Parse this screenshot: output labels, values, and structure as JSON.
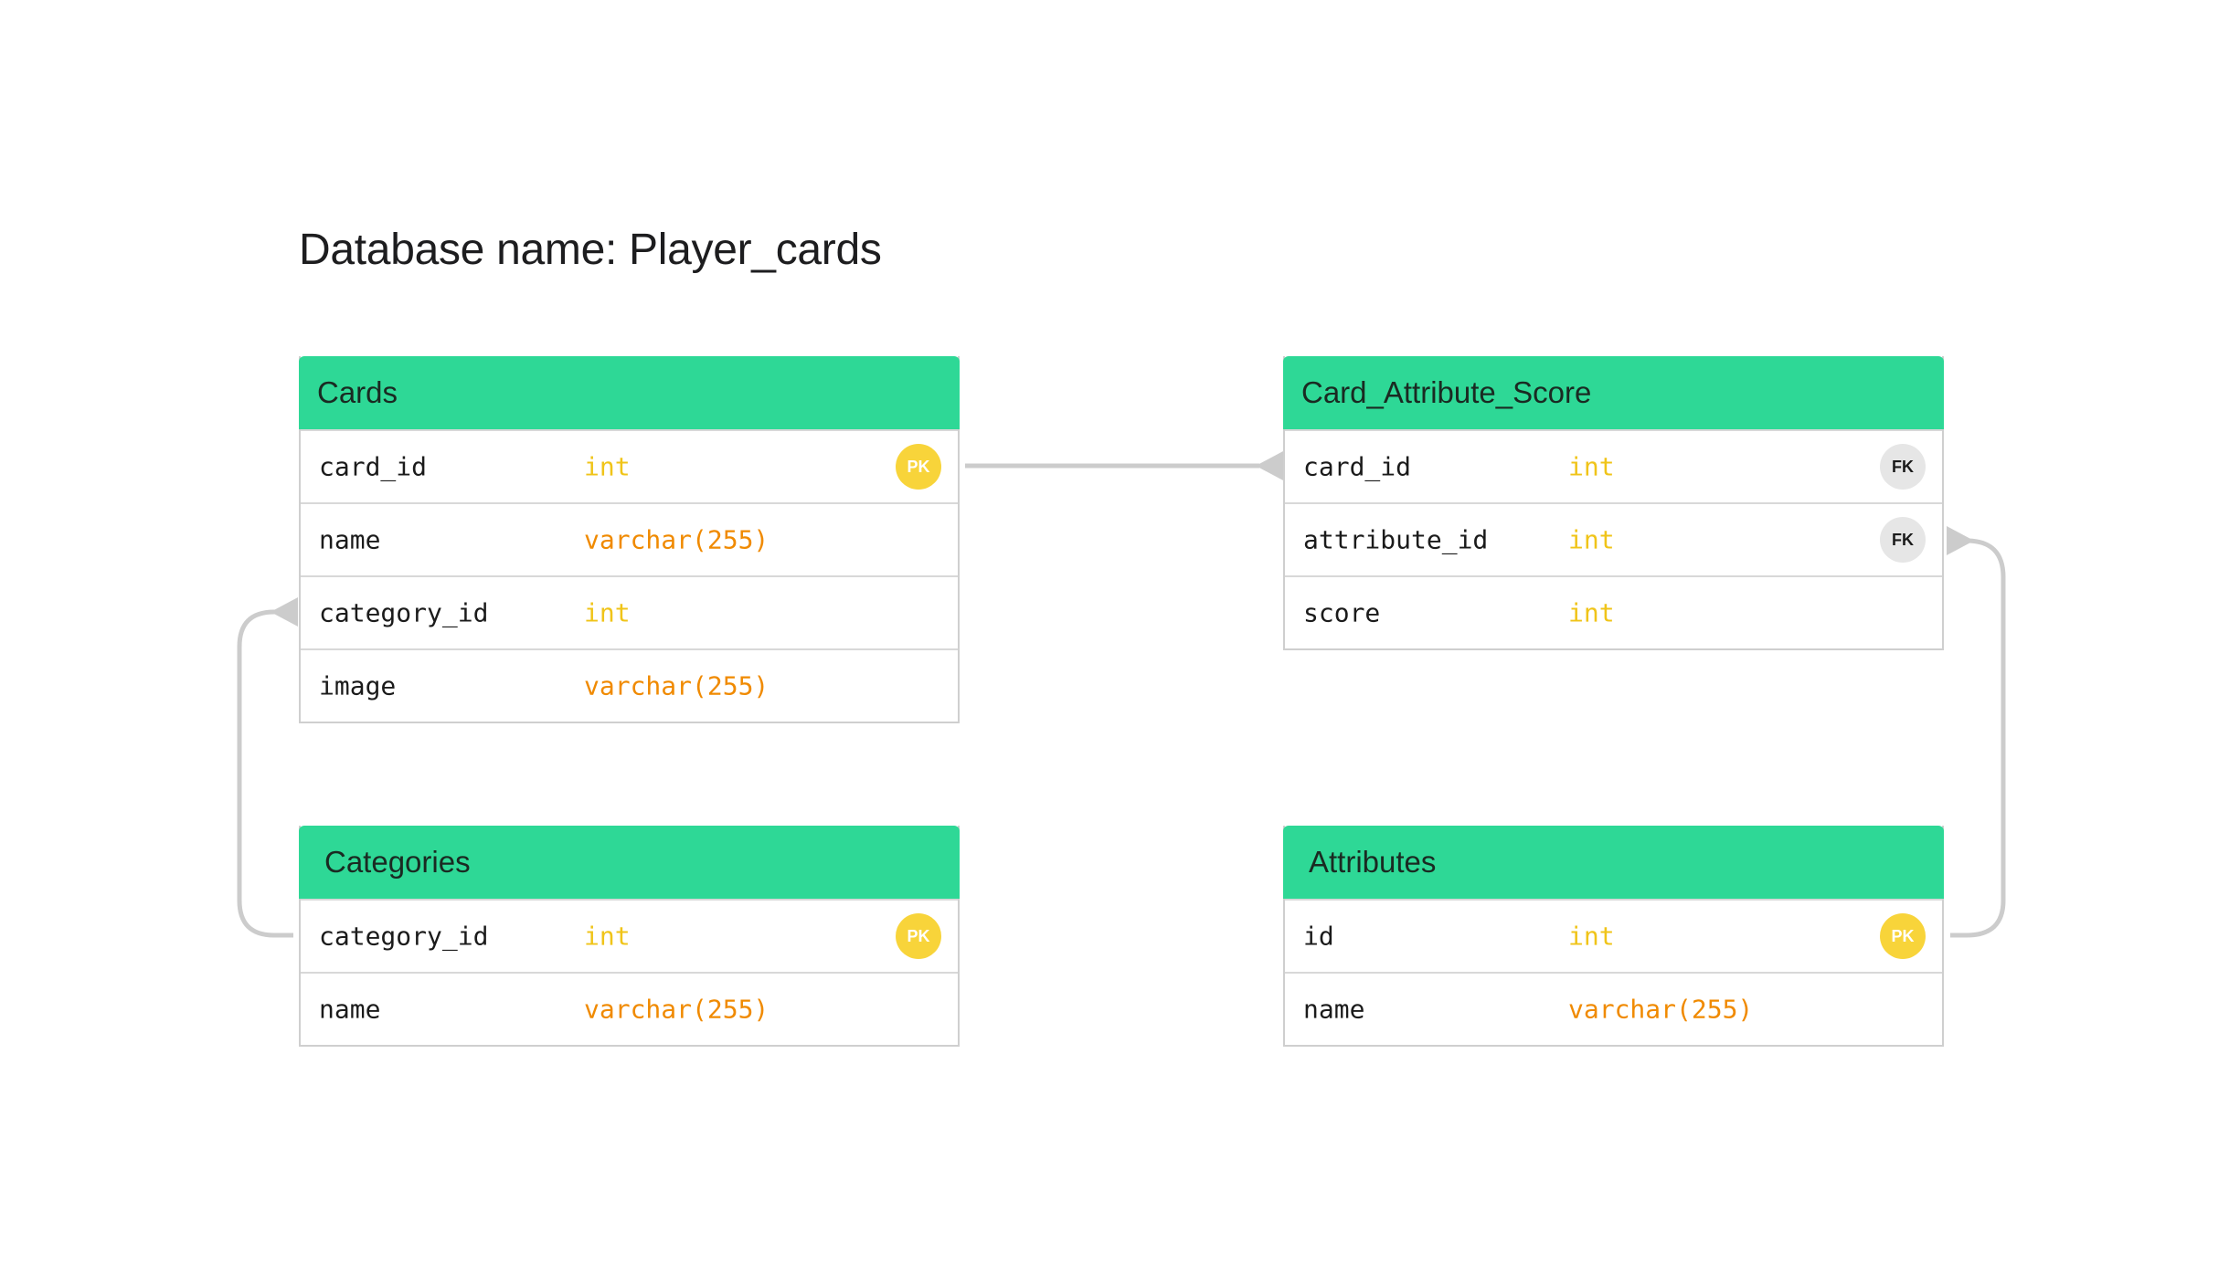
{
  "title": "Database name: Player_cards",
  "colors": {
    "header": "#2ed896",
    "int_type": "#f0c419",
    "varchar_type": "#f08a00",
    "pk_badge": "#f8d43a",
    "fk_badge": "#e6e6e6",
    "connector": "#cccccc"
  },
  "tables": {
    "cards": {
      "name": "Cards",
      "rows": [
        {
          "name": "card_id",
          "type": "int",
          "key": "PK"
        },
        {
          "name": "name",
          "type": "varchar(255)",
          "key": ""
        },
        {
          "name": "category_id",
          "type": "int",
          "key": ""
        },
        {
          "name": "image",
          "type": "varchar(255)",
          "key": ""
        }
      ]
    },
    "card_attribute_score": {
      "name": "Card_Attribute_Score",
      "rows": [
        {
          "name": "card_id",
          "type": "int",
          "key": "FK"
        },
        {
          "name": "attribute_id",
          "type": "int",
          "key": "FK"
        },
        {
          "name": "score",
          "type": "int",
          "key": ""
        }
      ]
    },
    "categories": {
      "name": "Categories",
      "rows": [
        {
          "name": "category_id",
          "type": "int",
          "key": "PK"
        },
        {
          "name": "name",
          "type": "varchar(255)",
          "key": ""
        }
      ]
    },
    "attributes": {
      "name": "Attributes",
      "rows": [
        {
          "name": "id",
          "type": "int",
          "key": "PK"
        },
        {
          "name": "name",
          "type": "varchar(255)",
          "key": ""
        }
      ]
    }
  }
}
